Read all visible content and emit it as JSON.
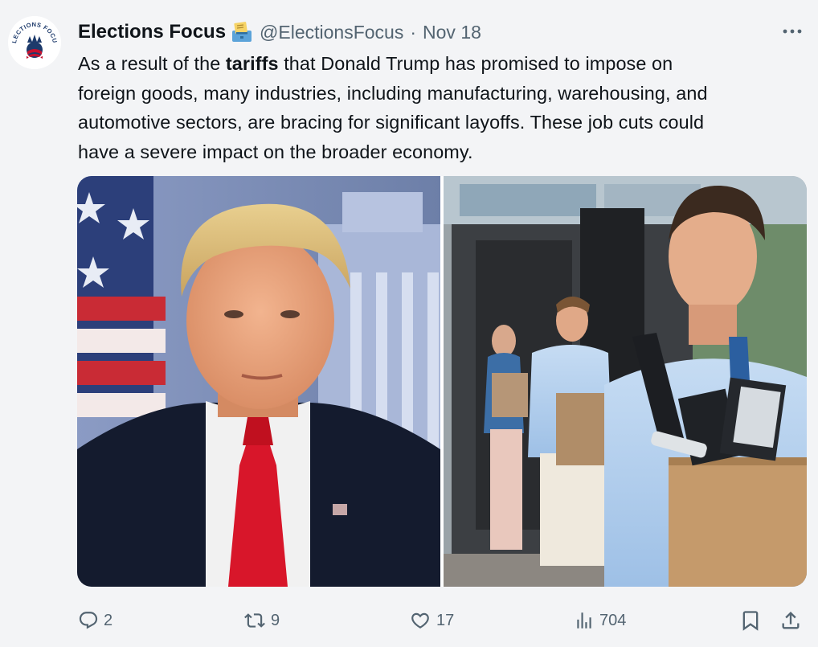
{
  "post": {
    "author": {
      "display_name": "Elections Focus",
      "handle": "@ElectionsFocus",
      "separator": "·",
      "date": "Nov 18",
      "name_emoji_icon": "ballot-box-icon",
      "avatar_logo_text": "ELECTIONS FOCUS"
    },
    "text": {
      "line1_before": "As a result of the ",
      "line1_bold": "tariffs",
      "line1_after": " that Donald Trump has promised to impose on",
      "line2": "foreign goods, many industries, including manufacturing, warehousing, and",
      "line3": "automotive sectors, are bracing for significant layoffs. These job cuts could",
      "line4": "have a severe impact on the broader economy."
    },
    "media": [
      {
        "name": "trump-portrait-photo"
      },
      {
        "name": "laid-off-workers-photo"
      }
    ],
    "actions": {
      "replies": "2",
      "reposts": "9",
      "likes": "17",
      "views": "704"
    }
  },
  "colors": {
    "background": "#f3f4f6",
    "text_primary": "#0f1419",
    "text_secondary": "#536471"
  }
}
